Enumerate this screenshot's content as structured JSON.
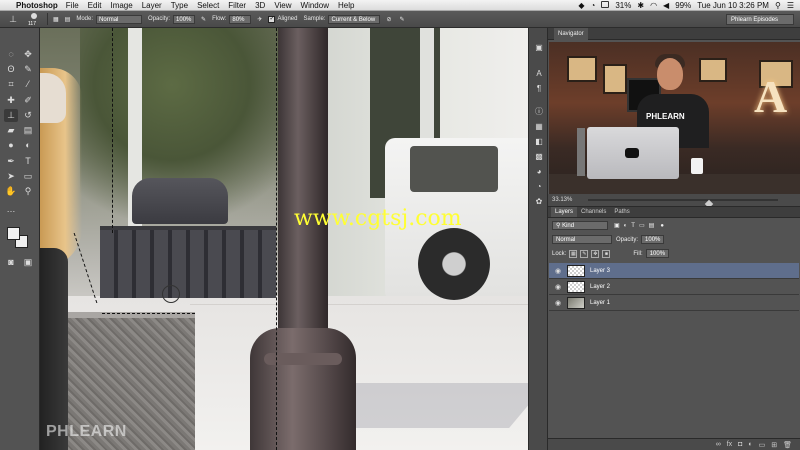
{
  "menubar": {
    "app_name": "Photoshop",
    "menus": [
      "File",
      "Edit",
      "Image",
      "Layer",
      "Type",
      "Select",
      "Filter",
      "3D",
      "View",
      "Window",
      "Help"
    ],
    "battery": "31%",
    "volume": "99%",
    "datetime": "Tue Jun 10  3:26 PM"
  },
  "options": {
    "brush_size": "117",
    "mode_label": "Mode:",
    "mode_value": "Normal",
    "opacity_label": "Opacity:",
    "opacity_value": "100%",
    "flow_label": "Flow:",
    "flow_value": "80%",
    "aligned_label": "Aligned",
    "sample_label": "Sample:",
    "sample_value": "Current & Below",
    "workspace": "Phlearn Episodes"
  },
  "canvas": {
    "watermark": "www.cgtsj.com",
    "logo": "PHLEARN"
  },
  "navigator": {
    "tab": "Navigator",
    "zoom": "33.13%",
    "shirt_text": "PHLEARN",
    "sign_letter": "A"
  },
  "layers": {
    "tabs": [
      "Layers",
      "Channels",
      "Paths"
    ],
    "kind_label": "Kind",
    "blend_mode": "Normal",
    "opacity_label": "Opacity:",
    "opacity_value": "100%",
    "lock_label": "Lock:",
    "fill_label": "Fill:",
    "fill_value": "100%",
    "items": [
      {
        "name": "Layer 3",
        "selected": true
      },
      {
        "name": "Layer 2",
        "selected": false
      },
      {
        "name": "Layer 1",
        "selected": false
      }
    ]
  },
  "colors": {
    "selected_layer": "#5f6e8c",
    "watermark": "#ffff33",
    "panel": "#535353"
  }
}
